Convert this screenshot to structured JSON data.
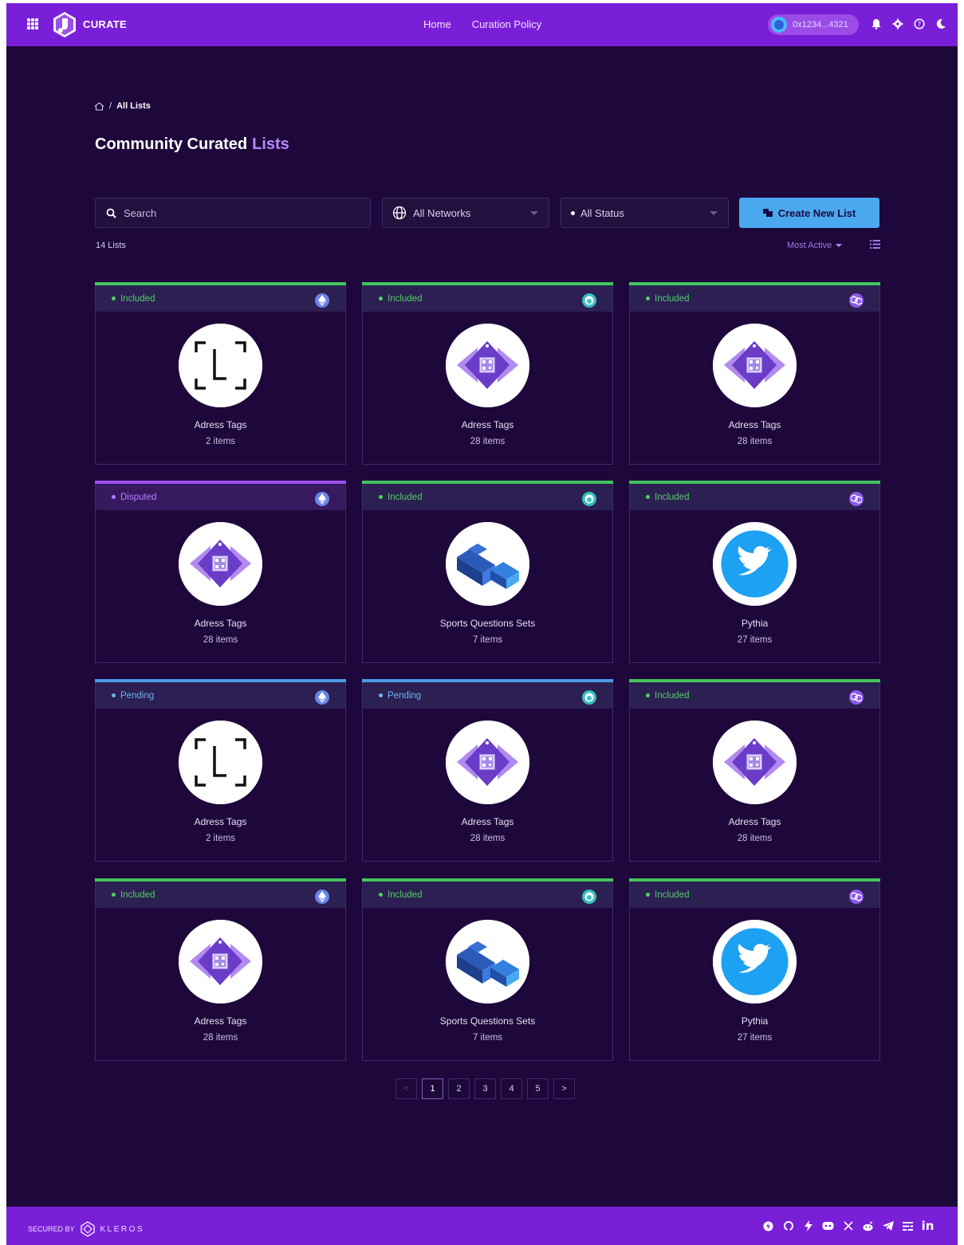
{
  "header": {
    "brand": "CURATE",
    "nav": [
      "Home",
      "Curation Policy"
    ],
    "account": "0x1234...4321",
    "icons": [
      "bell-icon",
      "gear-icon",
      "help-icon",
      "moon-icon"
    ]
  },
  "breadcrumb": {
    "current": "All Lists"
  },
  "title": {
    "main": "Community Curated",
    "accent": "Lists"
  },
  "search": {
    "placeholder": "Search"
  },
  "filters": {
    "network": "All Networks",
    "status": "All Status"
  },
  "create_button": "Create New List",
  "count": "14 Lists",
  "sort": "Most Active",
  "cards": [
    {
      "status": "Included",
      "title": "Adress Tags",
      "items": "2 items",
      "chain": "ethereum",
      "logo": "frame"
    },
    {
      "status": "Included",
      "title": "Adress Tags",
      "items": "28 items",
      "chain": "gnosis",
      "logo": "tag"
    },
    {
      "status": "Included",
      "title": "Adress Tags",
      "items": "28 items",
      "chain": "polygon",
      "logo": "tag"
    },
    {
      "status": "Disputed",
      "title": "Adress Tags",
      "items": "28 items",
      "chain": "ethereum",
      "logo": "tag"
    },
    {
      "status": "Included",
      "title": "Sports Questions Sets",
      "items": "7 items",
      "chain": "gnosis",
      "logo": "blocks"
    },
    {
      "status": "Included",
      "title": "Pythia",
      "items": "27 items",
      "chain": "polygon",
      "logo": "twitter"
    },
    {
      "status": "Pending",
      "title": "Adress Tags",
      "items": "2 items",
      "chain": "ethereum",
      "logo": "frame"
    },
    {
      "status": "Pending",
      "title": "Adress Tags",
      "items": "28 items",
      "chain": "gnosis",
      "logo": "tag"
    },
    {
      "status": "Included",
      "title": "Adress Tags",
      "items": "28 items",
      "chain": "polygon",
      "logo": "tag"
    },
    {
      "status": "Included",
      "title": "Adress Tags",
      "items": "28 items",
      "chain": "ethereum",
      "logo": "tag"
    },
    {
      "status": "Included",
      "title": "Sports Questions Sets",
      "items": "7 items",
      "chain": "gnosis",
      "logo": "blocks"
    },
    {
      "status": "Included",
      "title": "Pythia",
      "items": "27 items",
      "chain": "polygon",
      "logo": "twitter"
    }
  ],
  "pagination": {
    "prev": "<",
    "pages": [
      "1",
      "2",
      "3",
      "4",
      "5"
    ],
    "next": ">",
    "current": "1"
  },
  "footer": {
    "secured_by": "SECURED BY",
    "kleros": "KLEROS",
    "socials": [
      "snapshot-icon",
      "github-icon",
      "lightning-icon",
      "discord-icon",
      "x-icon",
      "reddit-icon",
      "telegram-icon",
      "ghost-icon",
      "linkedin-icon"
    ]
  },
  "colors": {
    "header": "#7a1fd8",
    "background": "#1e083b",
    "included": "#4fcf63",
    "disputed": "#b37dff",
    "pending": "#6eb3f5",
    "accent": "#b887ff",
    "button": "#4aa8ee"
  }
}
